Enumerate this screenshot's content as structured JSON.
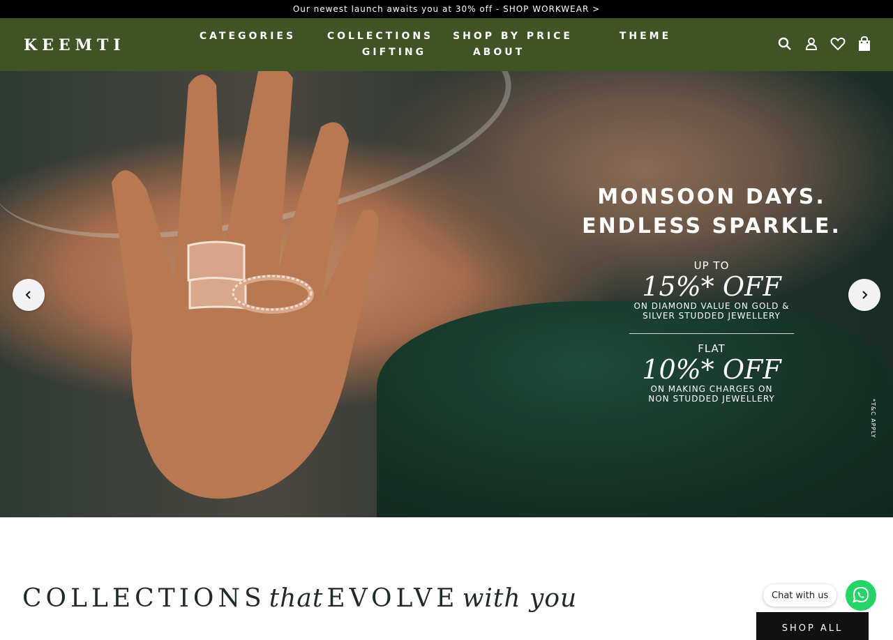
{
  "announcement": {
    "text": "Our newest launch awaits you at 30% off - SHOP WORKWEAR >"
  },
  "header": {
    "logo": "KEEMTI",
    "nav_row1": [
      "CATEGORIES",
      "COLLECTIONS",
      "SHOP BY PRICE",
      "THEME"
    ],
    "nav_row2": [
      "GIFTING",
      "ABOUT"
    ],
    "icons": [
      "search-icon",
      "account-icon",
      "wishlist-heart-icon",
      "shopping-bag-icon"
    ],
    "bg_color": "#3f5325"
  },
  "hero": {
    "headline_line1": "MONSOON DAYS.",
    "headline_line2": "ENDLESS SPARKLE.",
    "offer1_prefix": "UP TO",
    "offer1_value": "15%* OFF",
    "offer1_line1": "ON DIAMOND VALUE ON GOLD &",
    "offer1_line2": "SILVER STUDDED JEWELLERY",
    "offer2_prefix": "FLAT",
    "offer2_value": "10%* OFF",
    "offer2_line1": "ON MAKING CHARGES ON",
    "offer2_line2": "NON STUDDED JEWELLERY",
    "terms": "*T&C APPLY",
    "prev_icon": "chevron-left-icon",
    "next_icon": "chevron-right-icon"
  },
  "collections": {
    "word1": "COLLECTIONS",
    "word2": "that",
    "word3": "EVOLVE",
    "word4": "with you",
    "shop_all": "SHOP ALL"
  },
  "chat": {
    "label": "Chat with us",
    "icon": "whatsapp-icon",
    "color": "#25d366"
  }
}
